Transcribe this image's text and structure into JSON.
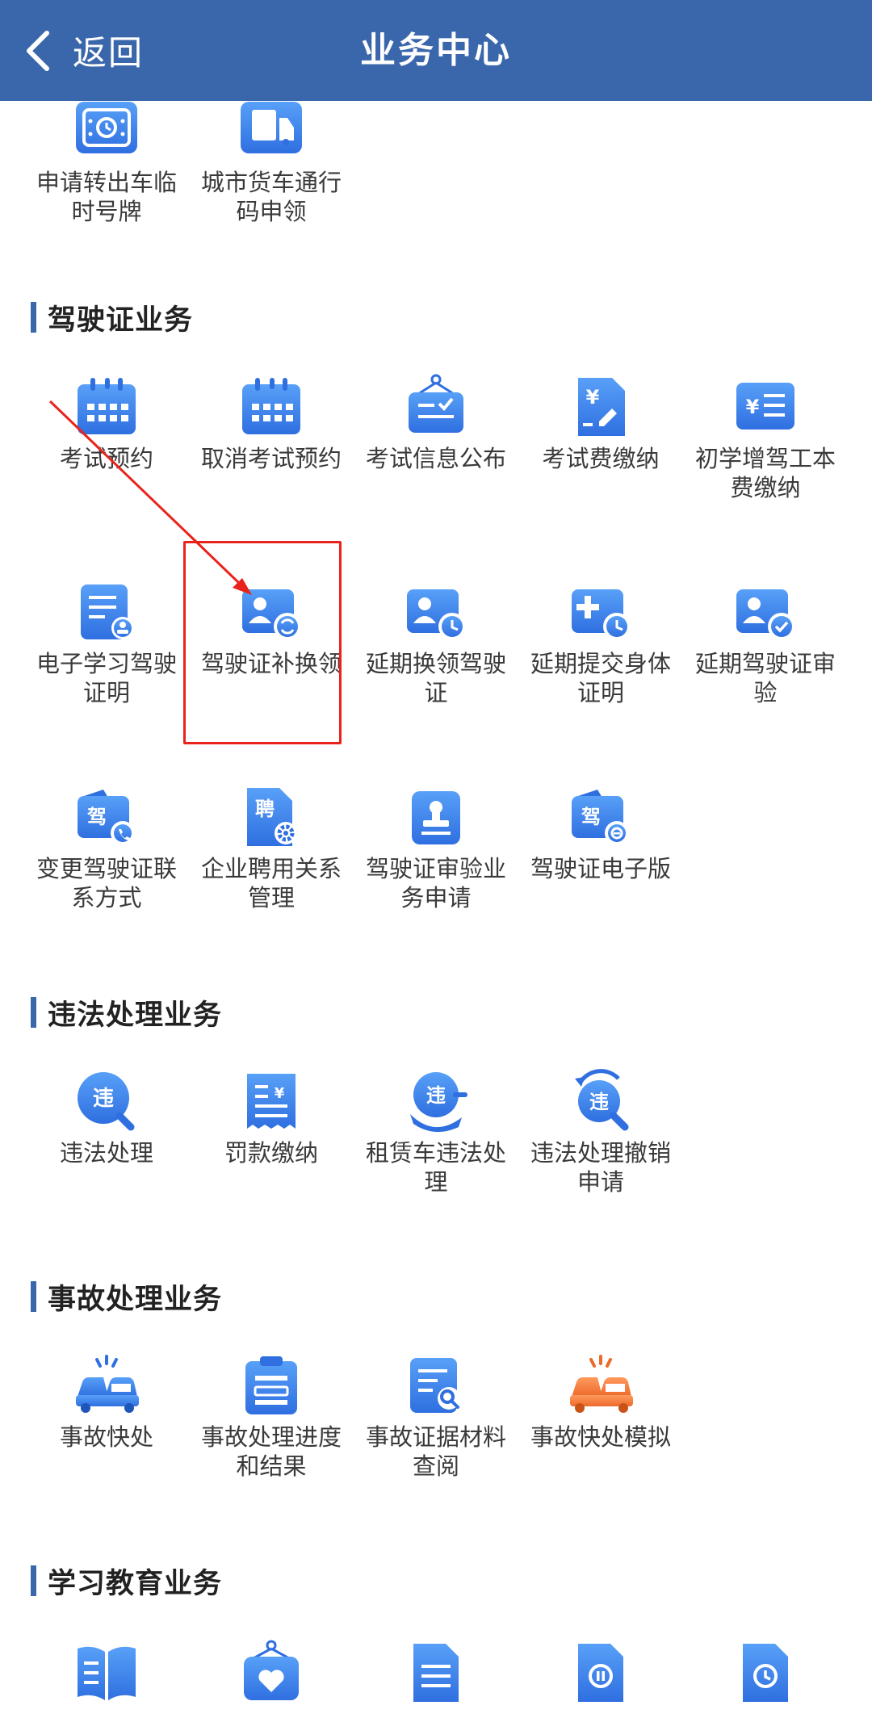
{
  "header": {
    "back_label": "返回",
    "title": "业务中心"
  },
  "top_items": [
    {
      "label": "申请转出车临时号牌",
      "icon": "temp-plate-icon"
    },
    {
      "label": "城市货车通行码申领",
      "icon": "truck-icon"
    }
  ],
  "driving": {
    "title": "驾驶证业务",
    "items": [
      {
        "label": "考试预约",
        "icon": "calendar-icon"
      },
      {
        "label": "取消考试预约",
        "icon": "calendar-cancel-icon"
      },
      {
        "label": "考试信息公布",
        "icon": "notice-board-icon"
      },
      {
        "label": "考试费缴纳",
        "icon": "fee-document-icon"
      },
      {
        "label": "初学增驾工本费缴纳",
        "icon": "fee-list-icon"
      },
      {
        "label": "电子学习驾驶证明",
        "icon": "e-learning-certificate-icon"
      },
      {
        "label": "驾驶证补换领",
        "icon": "license-reissue-icon"
      },
      {
        "label": "延期换领驾驶证",
        "icon": "license-extend-icon"
      },
      {
        "label": "延期提交身体证明",
        "icon": "medical-extend-icon"
      },
      {
        "label": "延期驾驶证审验",
        "icon": "license-verify-icon"
      },
      {
        "label": "变更驾驶证联系方式",
        "icon": "contact-change-icon",
        "glyph": "驾"
      },
      {
        "label": "企业聘用关系管理",
        "icon": "employment-doc-icon",
        "glyph": "聘"
      },
      {
        "label": "驾驶证审验业务申请",
        "icon": "stamp-icon"
      },
      {
        "label": "驾驶证电子版",
        "icon": "e-license-icon",
        "glyph": "驾"
      }
    ]
  },
  "violation": {
    "title": "违法处理业务",
    "items": [
      {
        "label": "违法处理",
        "icon": "violation-search-icon",
        "glyph": "违"
      },
      {
        "label": "罚款缴纳",
        "icon": "fine-receipt-icon"
      },
      {
        "label": "租赁车违法处理",
        "icon": "rental-violation-icon",
        "glyph": "违"
      },
      {
        "label": "违法处理撤销申请",
        "icon": "violation-revoke-icon",
        "glyph": "违"
      }
    ]
  },
  "accident": {
    "title": "事故处理业务",
    "items": [
      {
        "label": "事故快处",
        "icon": "car-crash-icon"
      },
      {
        "label": "事故处理进度和结果",
        "icon": "clipboard-progress-icon"
      },
      {
        "label": "事故证据材料查阅",
        "icon": "document-search-icon"
      },
      {
        "label": "事故快处模拟",
        "icon": "car-crash-simulation-icon"
      }
    ]
  },
  "education": {
    "title": "学习教育业务",
    "items": [
      {
        "label": "",
        "icon": "book-icon"
      },
      {
        "label": "",
        "icon": "heart-badge-icon"
      },
      {
        "label": "",
        "icon": "document-lines-icon"
      },
      {
        "label": "",
        "icon": "document-pause-icon"
      },
      {
        "label": "",
        "icon": "document-clock-icon"
      }
    ]
  },
  "colors": {
    "header": "#3a67ab",
    "icon_blue": "#3b7be6",
    "icon_orange": "#f07a3a",
    "annotation_red": "#e8231b"
  }
}
